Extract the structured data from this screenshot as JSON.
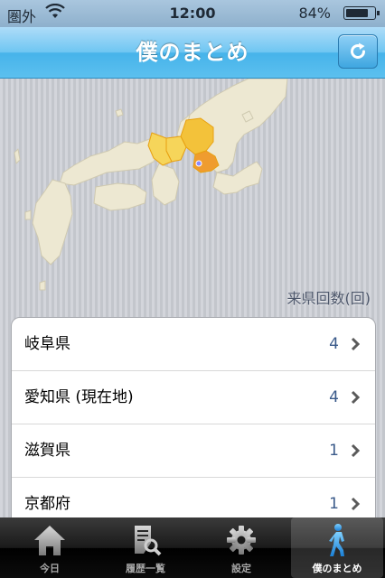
{
  "status_bar": {
    "carrier": "圏外",
    "time": "12:00",
    "battery": "84%",
    "battery_level": 0.84
  },
  "nav": {
    "title": "僕のまとめ",
    "refresh_icon": "refresh-icon"
  },
  "map": {
    "visited_colors": {
      "gifu": "#f3c23a",
      "aichi": "#ef9c2f",
      "shiga": "#f6d55a",
      "kyoto": "#f6d55a",
      "base_land": "#ede8d2"
    }
  },
  "section_label": "来県回数(回)",
  "list": [
    {
      "name": "岐阜県",
      "count": "4"
    },
    {
      "name": "愛知県 (現在地)",
      "count": "4"
    },
    {
      "name": "滋賀県",
      "count": "1"
    },
    {
      "name": "京都府",
      "count": "1"
    }
  ],
  "tabs": [
    {
      "label": "今日",
      "icon": "home-icon",
      "active": false
    },
    {
      "label": "履歴一覧",
      "icon": "history-search-icon",
      "active": false
    },
    {
      "label": "設定",
      "icon": "gear-icon",
      "active": false
    },
    {
      "label": "僕のまとめ",
      "icon": "walking-person-icon",
      "active": true
    }
  ]
}
